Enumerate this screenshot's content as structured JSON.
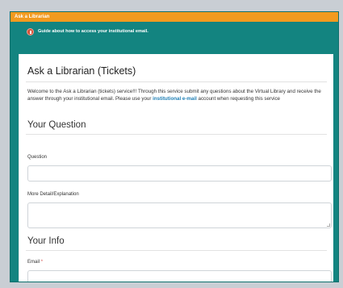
{
  "window": {
    "title": "Ask a Librarian"
  },
  "guide": {
    "text": "Guide about how to access your institutional email."
  },
  "page": {
    "title": "Ask a Librarian (Tickets)",
    "intro_part1": "Welcome to the Ask a Librarian (tickets) service!!! Through this service submit any questions about the Virtual Library and receive the answer through your institutional email. Please use your ",
    "intro_link": "institutional e-mail",
    "intro_part2": " account when requesting this service"
  },
  "question_section": {
    "title": "Your Question",
    "question_label": "Question",
    "question_value": "",
    "detail_label": "More Detail/Explanation",
    "detail_value": ""
  },
  "info_section": {
    "title": "Your Info",
    "email_label": "Email",
    "email_required": "*",
    "email_value": ""
  },
  "colors": {
    "titlebar": "#f29a1f",
    "frame": "#138480",
    "link": "#1f7fb5",
    "required": "#d9534f"
  },
  "icons": {
    "guide": "info-circle-icon"
  }
}
